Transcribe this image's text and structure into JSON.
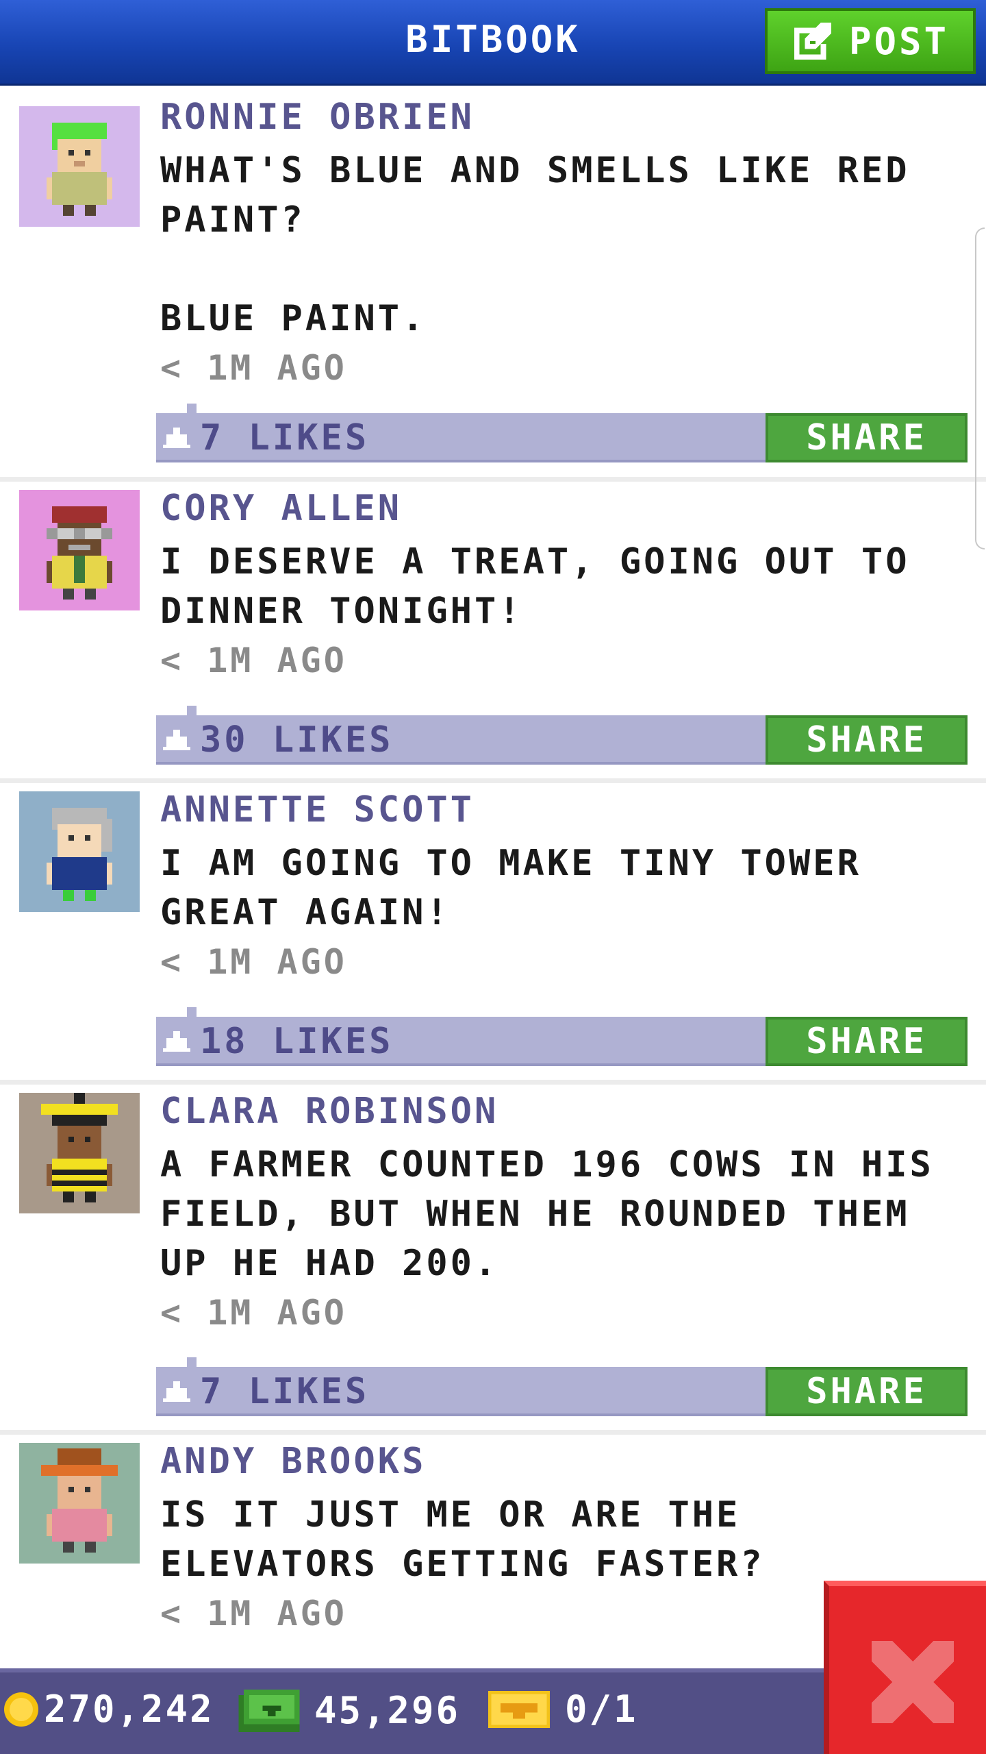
{
  "header": {
    "title": "BITBOOK",
    "post_label": "POST"
  },
  "posts": [
    {
      "author": "RONNIE OBRIEN",
      "message": "WHAT'S BLUE AND SMELLS LIKE RED PAINT?\n\nBLUE PAINT.",
      "time": "< 1M AGO",
      "likes": "7 LIKES",
      "share_label": "SHARE",
      "avatar_bg": "#d4b8ec"
    },
    {
      "author": "CORY ALLEN",
      "message": "I DESERVE A TREAT, GOING OUT TO DINNER TONIGHT!",
      "time": "< 1M AGO",
      "likes": "30 LIKES",
      "share_label": "SHARE",
      "avatar_bg": "#e493de"
    },
    {
      "author": "ANNETTE SCOTT",
      "message": "I AM GOING TO MAKE TINY TOWER GREAT AGAIN!",
      "time": "< 1M AGO",
      "likes": "18 LIKES",
      "share_label": "SHARE",
      "avatar_bg": "#8fafc8"
    },
    {
      "author": "CLARA ROBINSON",
      "message": "A FARMER COUNTED 196 COWS IN HIS FIELD, BUT WHEN HE ROUNDED THEM UP HE HAD 200.",
      "time": "< 1M AGO",
      "likes": "7 LIKES",
      "share_label": "SHARE",
      "avatar_bg": "#a8998a"
    },
    {
      "author": "ANDY BROOKS",
      "message": "IS IT JUST ME OR ARE THE ELEVATORS GETTING FASTER?",
      "time": "< 1M AGO",
      "likes": "",
      "share_label": "",
      "avatar_bg": "#8fb3a0"
    }
  ],
  "status": {
    "coins": "270,242",
    "bux": "45,296",
    "tickets": "0/1"
  },
  "icons": {
    "post": "edit-icon",
    "like": "thumbs-up-icon",
    "coin": "coin-icon",
    "bux": "bux-icon",
    "ticket": "golden-ticket-icon",
    "close": "close-icon"
  },
  "colors": {
    "header": "#1e4dbf",
    "post_button": "#4cbb1f",
    "share_button": "#4ea63f",
    "like_bar": "#b0b1d4",
    "author_text": "#58558f",
    "status_bar": "#524f86",
    "close_button": "#e6272b"
  }
}
